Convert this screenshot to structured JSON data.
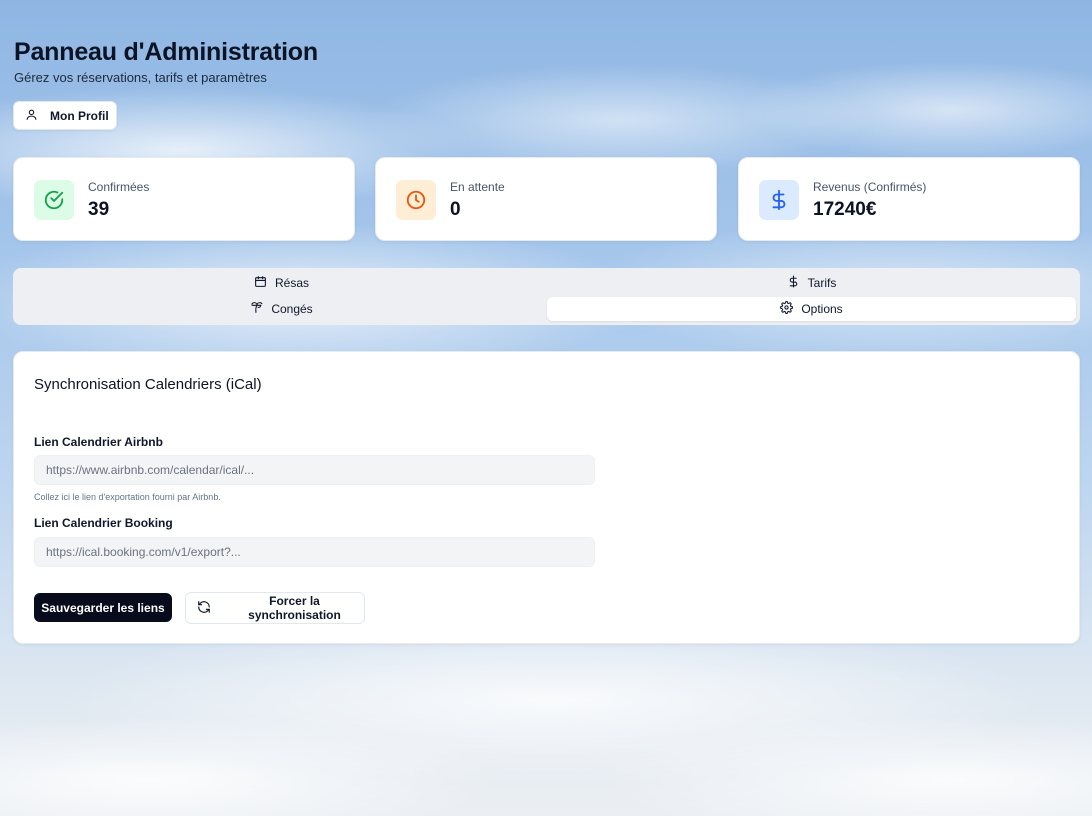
{
  "header": {
    "title": "Panneau d'Administration",
    "subtitle": "Gérez vos réservations, tarifs et paramètres",
    "profile_button": "Mon Profil",
    "profile_icon": "user-icon"
  },
  "stats": [
    {
      "label": "Confirmées",
      "value": "39",
      "icon": "check-circle-icon",
      "icon_color": "#16a34a",
      "icon_bg": "#dcfce7"
    },
    {
      "label": "En attente",
      "value": "0",
      "icon": "clock-icon",
      "icon_color": "#ea580c",
      "icon_bg": "#ffedd5"
    },
    {
      "label": "Revenus (Confirmés)",
      "value": "17240€",
      "icon": "dollar-icon",
      "icon_color": "#2563eb",
      "icon_bg": "#dbeafe"
    }
  ],
  "tabs": [
    {
      "label": "Résas",
      "icon": "calendar-icon",
      "active": false
    },
    {
      "label": "Tarifs",
      "icon": "dollar-icon",
      "active": false
    },
    {
      "label": "Congés",
      "icon": "palm-tree-icon",
      "active": false
    },
    {
      "label": "Options",
      "icon": "gear-icon",
      "active": true
    }
  ],
  "sync_panel": {
    "title": "Synchronisation Calendriers (iCal)",
    "airbnb": {
      "label": "Lien Calendrier Airbnb",
      "placeholder": "https://www.airbnb.com/calendar/ical/...",
      "value": "",
      "hint": "Collez ici le lien d'exportation fourni par Airbnb."
    },
    "booking": {
      "label": "Lien Calendrier Booking",
      "placeholder": "https://ical.booking.com/v1/export?...",
      "value": ""
    },
    "save_button": "Sauvegarder les liens",
    "sync_button": "Forcer la synchronisation",
    "sync_icon": "refresh-icon"
  }
}
